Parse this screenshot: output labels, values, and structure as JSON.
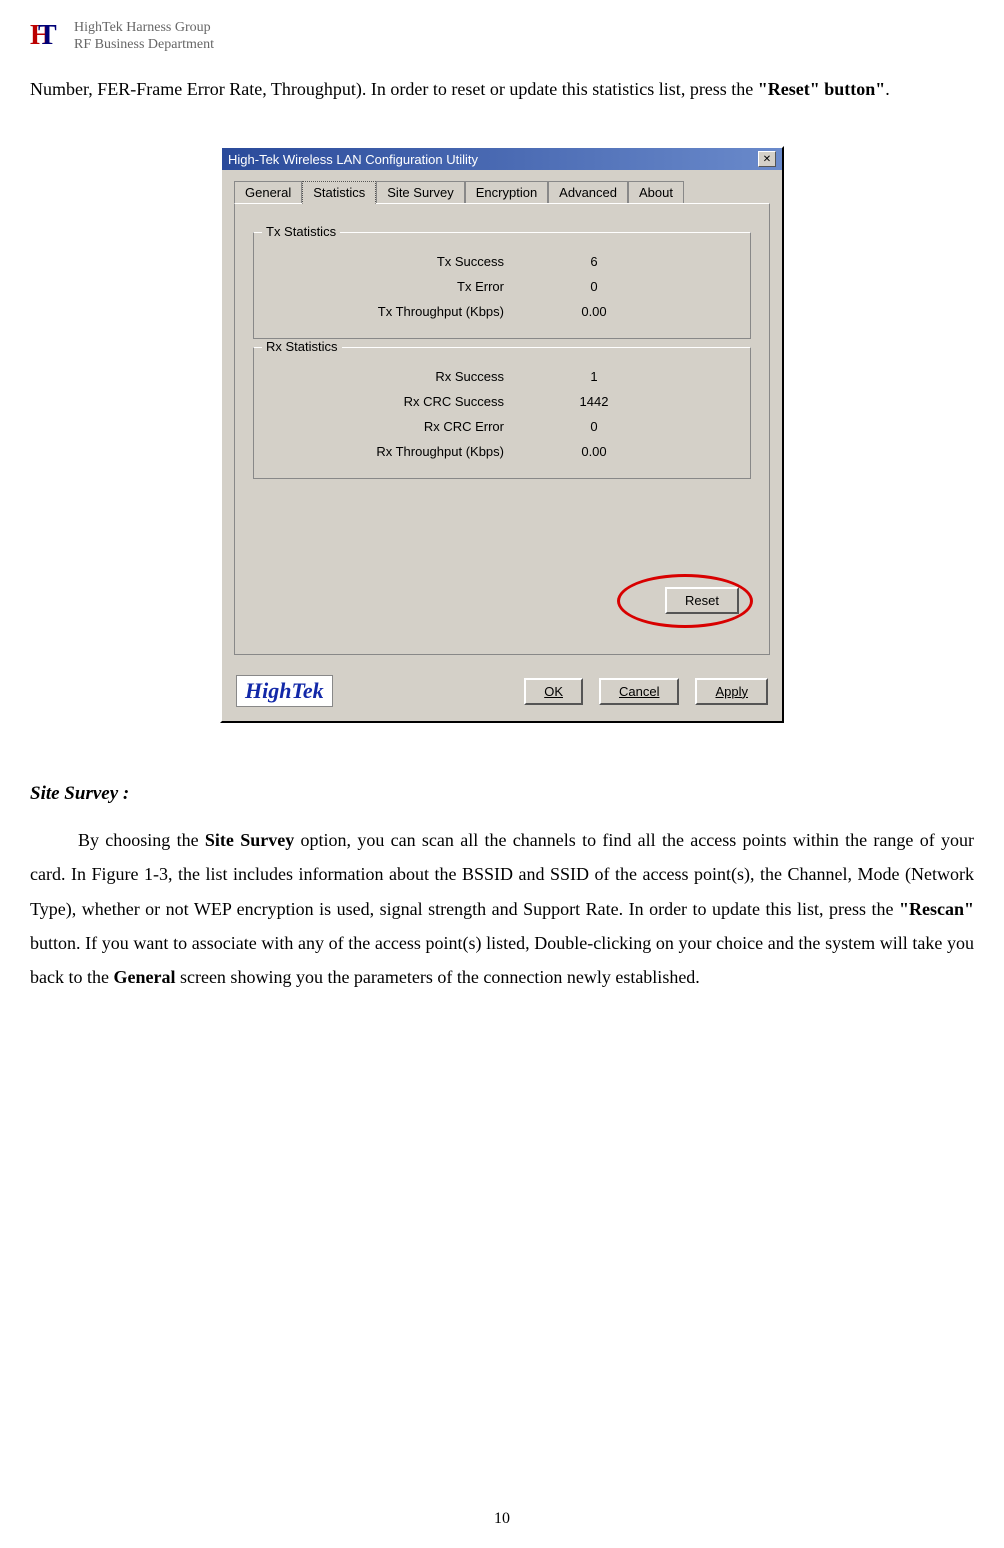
{
  "header": {
    "company_line1": "HighTek Harness Group",
    "company_line2": "RF Business Department"
  },
  "top_paragraph": {
    "prefix": "Number, FER-Frame Error Rate, Throughput). In order to reset or update this statistics list, press the ",
    "bold": "\"Reset\" button\"",
    "suffix": "."
  },
  "window": {
    "title": "High-Tek Wireless LAN Configuration Utility",
    "tabs": [
      "General",
      "Statistics",
      "Site Survey",
      "Encryption",
      "Advanced",
      "About"
    ],
    "active_tab_index": 1,
    "tx_group": {
      "title": "Tx Statistics",
      "rows": [
        {
          "label": "Tx Success",
          "value": "6"
        },
        {
          "label": "Tx Error",
          "value": "0"
        },
        {
          "label": "Tx Throughput (Kbps)",
          "value": "0.00"
        }
      ]
    },
    "rx_group": {
      "title": "Rx Statistics",
      "rows": [
        {
          "label": "Rx Success",
          "value": "1"
        },
        {
          "label": "Rx CRC Success",
          "value": "1442"
        },
        {
          "label": "Rx CRC Error",
          "value": "0"
        },
        {
          "label": "Rx Throughput (Kbps)",
          "value": "0.00"
        }
      ]
    },
    "reset_label": "Reset",
    "logo_text": "HighTek",
    "ok": "OK",
    "cancel": "Cancel",
    "apply": "Apply",
    "close_x": "✕"
  },
  "section": {
    "title": "Site Survey :",
    "p1_a": "By choosing the ",
    "p1_b_bold": "Site Survey",
    "p1_c": " option, you can scan all the channels to find all the access points within the range of your card. In Figure 1-3, the list includes information about the BSSID and SSID of the access point(s), the Channel, Mode (Network Type), whether or not WEP encryption is used, signal strength and Support Rate. In order to update this list, press the ",
    "p1_d_bold": "\"Rescan\"",
    "p1_e": " button. If you want to associate with any of the access point(s) listed, Double-clicking on your choice and the system will take you back to the ",
    "p1_f_bold": "General",
    "p1_g": " screen showing you the parameters of the connection newly established."
  },
  "page_number": "10"
}
